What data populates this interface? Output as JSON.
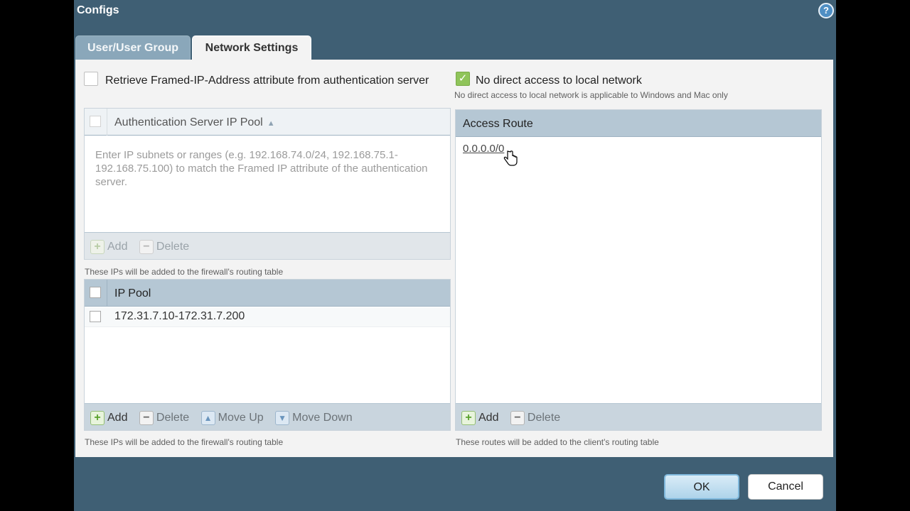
{
  "dialog": {
    "title": "Configs",
    "help": "?"
  },
  "tabs": [
    {
      "label": "User/User Group",
      "active": false
    },
    {
      "label": "Network Settings",
      "active": true
    }
  ],
  "settings": {
    "retrieve_framed_ip": {
      "label": "Retrieve Framed-IP-Address attribute from authentication server",
      "checked": false
    },
    "no_direct_access": {
      "label": "No direct access to local network",
      "checked": true,
      "note": "No direct access to local network is applicable to Windows and Mac only"
    }
  },
  "auth_pool": {
    "column": "Authentication Server IP Pool",
    "placeholder": "Enter IP subnets or ranges (e.g. 192.168.74.0/24, 192.168.75.1-192.168.75.100) to match the Framed IP attribute of the authentication server.",
    "add_label": "Add",
    "delete_label": "Delete",
    "note": "These IPs will be added to the firewall's routing table"
  },
  "ip_pool": {
    "column": "IP Pool",
    "rows": [
      "172.31.7.10-172.31.7.200"
    ],
    "add_label": "Add",
    "delete_label": "Delete",
    "move_up_label": "Move Up",
    "move_down_label": "Move Down",
    "note": "These IPs will be added to the firewall's routing table"
  },
  "access_route": {
    "column": "Access Route",
    "rows": [
      "0.0.0.0/0"
    ],
    "add_label": "Add",
    "delete_label": "Delete",
    "note": "These routes will be added to the client's routing table"
  },
  "footer": {
    "ok_label": "OK",
    "cancel_label": "Cancel"
  },
  "colors": {
    "frame": "#3f5f74",
    "header": "#b5c7d4",
    "check": "#8fc45a"
  }
}
